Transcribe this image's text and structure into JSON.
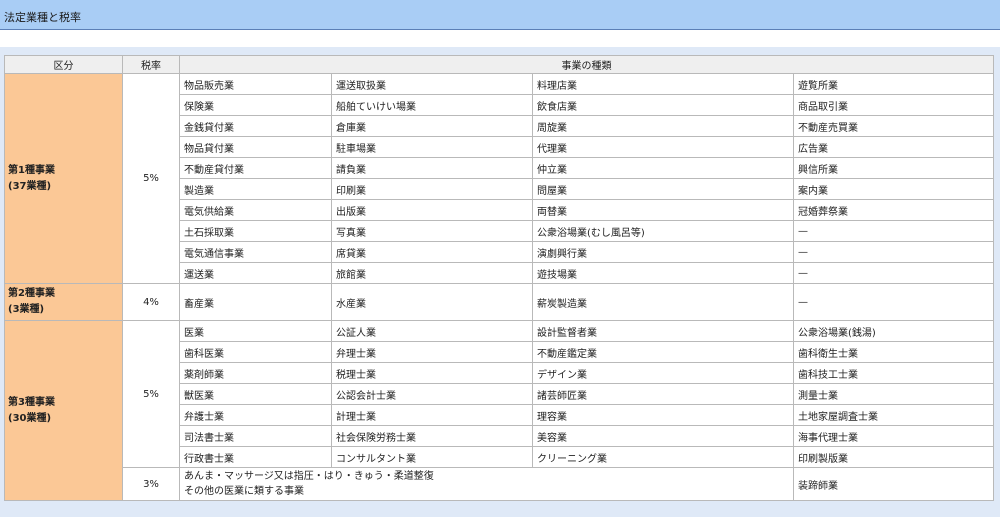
{
  "header": {
    "title": "法定業種と税率"
  },
  "table": {
    "headers": [
      "区分",
      "税率",
      "事業の種類"
    ],
    "cat1": {
      "name": "第1種事業",
      "count": "(37業種)",
      "rate": "5%",
      "rows": [
        [
          "物品販売業",
          "運送取扱業",
          "料理店業",
          "遊覧所業"
        ],
        [
          "保険業",
          "船舶ていけい場業",
          "飲食店業",
          "商品取引業"
        ],
        [
          "金銭貸付業",
          "倉庫業",
          "周旋業",
          "不動産売買業"
        ],
        [
          "物品貸付業",
          "駐車場業",
          "代理業",
          "広告業"
        ],
        [
          "不動産貸付業",
          "請負業",
          "仲立業",
          "興信所業"
        ],
        [
          "製造業",
          "印刷業",
          "問屋業",
          "案内業"
        ],
        [
          "電気供給業",
          "出版業",
          "両替業",
          "冠婚葬祭業"
        ],
        [
          "土石採取業",
          "写真業",
          "公衆浴場業(むし風呂等)",
          "—"
        ],
        [
          "電気通信事業",
          "席貸業",
          "演劇興行業",
          "—"
        ],
        [
          "運送業",
          "旅館業",
          "遊技場業",
          "—"
        ]
      ]
    },
    "cat2": {
      "name": "第2種事業",
      "count": "(3業種)",
      "rate": "4%",
      "rows": [
        [
          "畜産業",
          "水産業",
          "薪炭製造業",
          "—"
        ]
      ]
    },
    "cat3": {
      "name": "第3種事業",
      "count": "(30業種)",
      "rate": "5%",
      "rate2": "3%",
      "rows": [
        [
          "医業",
          "公証人業",
          "設計監督者業",
          "公衆浴場業(銭湯)"
        ],
        [
          "歯科医業",
          "弁理士業",
          "不動産鑑定業",
          "歯科衛生士業"
        ],
        [
          "薬剤師業",
          "税理士業",
          "デザイン業",
          "歯科技工士業"
        ],
        [
          "獣医業",
          "公認会計士業",
          "諸芸師匠業",
          "測量士業"
        ],
        [
          "弁護士業",
          "計理士業",
          "理容業",
          "土地家屋調査士業"
        ],
        [
          "司法書士業",
          "社会保険労務士業",
          "美容業",
          "海事代理士業"
        ],
        [
          "行政書士業",
          "コンサルタント業",
          "クリーニング業",
          "印刷製版業"
        ]
      ],
      "last_row": {
        "line1": "あんま・マッサージ又は指圧・はり・きゅう・柔道整復",
        "line2": "その他の医業に類する事業",
        "col4": "装蹄師業"
      }
    }
  }
}
